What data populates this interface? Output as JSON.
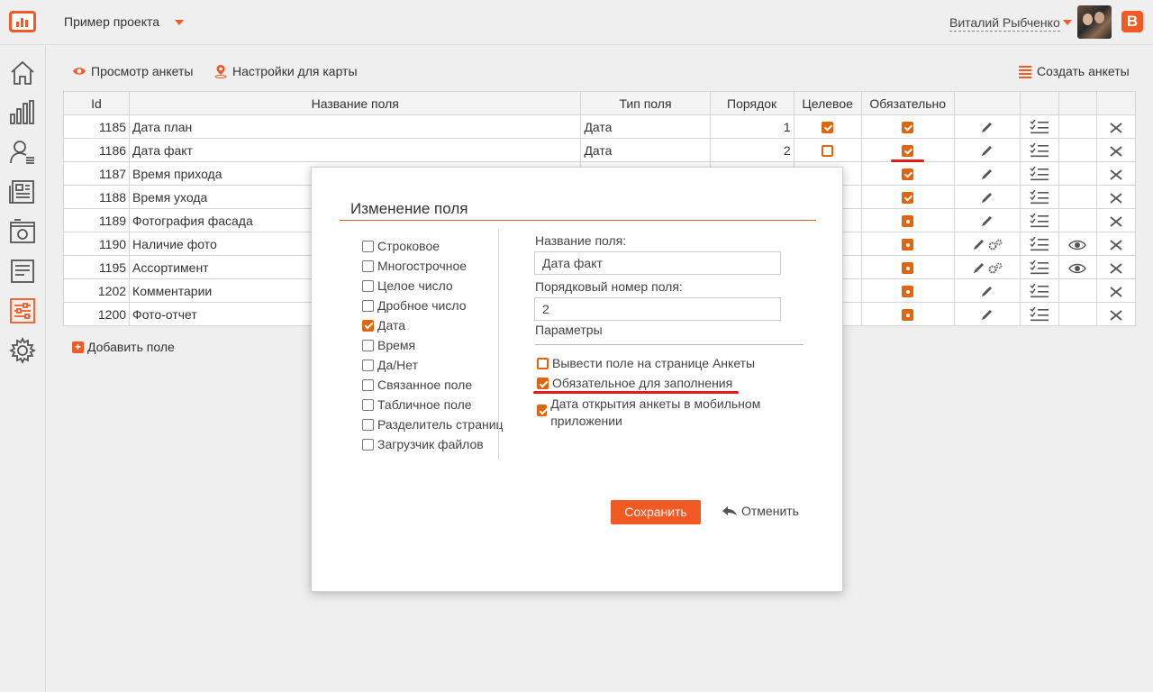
{
  "header": {
    "project": "Пример проекта",
    "user_name": "Виталий Рыбченко",
    "blogger_letter": "B"
  },
  "sidebar": {
    "items": [
      "home-icon",
      "chart-icon",
      "users-icon",
      "newspaper-icon",
      "image-icon",
      "document-icon",
      "settings-sliders-icon",
      "gear-icon"
    ]
  },
  "toolbar": {
    "view_form": "Просмотр анкеты",
    "map_settings": "Настройки для карты",
    "create_forms": "Создать анкеты"
  },
  "table": {
    "columns": [
      "Id",
      "Название поля",
      "Тип поля",
      "Порядок",
      "Целевое",
      "Обязательно"
    ],
    "rows": [
      {
        "id": "1185",
        "name": "Дата план",
        "type": "Дата",
        "order": "1",
        "target": "checked",
        "required": "checked"
      },
      {
        "id": "1186",
        "name": "Дата факт",
        "type": "Дата",
        "order": "2",
        "target": "unchecked",
        "required": "checked"
      },
      {
        "id": "1187",
        "name": "Время прихода",
        "type": "",
        "order": "",
        "target": "",
        "required": "checked"
      },
      {
        "id": "1188",
        "name": "Время ухода",
        "type": "",
        "order": "",
        "target": "",
        "required": "checked"
      },
      {
        "id": "1189",
        "name": "Фотография фасада",
        "type": "",
        "order": "",
        "target": "",
        "required": "dot"
      },
      {
        "id": "1190",
        "name": "Наличие фото",
        "type": "",
        "order": "",
        "target": "",
        "required": "dot"
      },
      {
        "id": "1195",
        "name": "Ассортимент",
        "type": "",
        "order": "",
        "target": "",
        "required": "dot"
      },
      {
        "id": "1202",
        "name": "Комментарии",
        "type": "",
        "order": "",
        "target": "",
        "required": "dot"
      },
      {
        "id": "1200",
        "name": "Фото-отчет",
        "type": "",
        "order": "",
        "target": "",
        "required": "dot"
      }
    ]
  },
  "add_field": "Добавить поле",
  "modal": {
    "title": "Изменение поля",
    "types": [
      {
        "label": "Строковое",
        "checked": false
      },
      {
        "label": "Многострочное",
        "checked": false
      },
      {
        "label": "Целое число",
        "checked": false
      },
      {
        "label": "Дробное число",
        "checked": false
      },
      {
        "label": "Дата",
        "checked": true
      },
      {
        "label": "Время",
        "checked": false
      },
      {
        "label": "Да/Нет",
        "checked": false
      },
      {
        "label": "Связанное поле",
        "checked": false
      },
      {
        "label": "Табличное поле",
        "checked": false
      },
      {
        "label": "Разделитель страниц",
        "checked": false
      },
      {
        "label": "Загрузчик файлов",
        "checked": false
      }
    ],
    "field_name_label": "Название поля:",
    "field_name_value": "Дата факт",
    "order_label": "Порядковый номер поля:",
    "order_value": "2",
    "params_label": "Параметры",
    "opt_show": "Вывести поле на странице Анкеты",
    "opt_required": "Обязательное для заполнения",
    "opt_date": "Дата открытия анкеты в мобильном приложении",
    "save": "Сохранить",
    "cancel": "Отменить"
  },
  "colors": {
    "accent": "#f15a24",
    "checkbox": "#e0650f",
    "highlight": "#e21b1b"
  }
}
